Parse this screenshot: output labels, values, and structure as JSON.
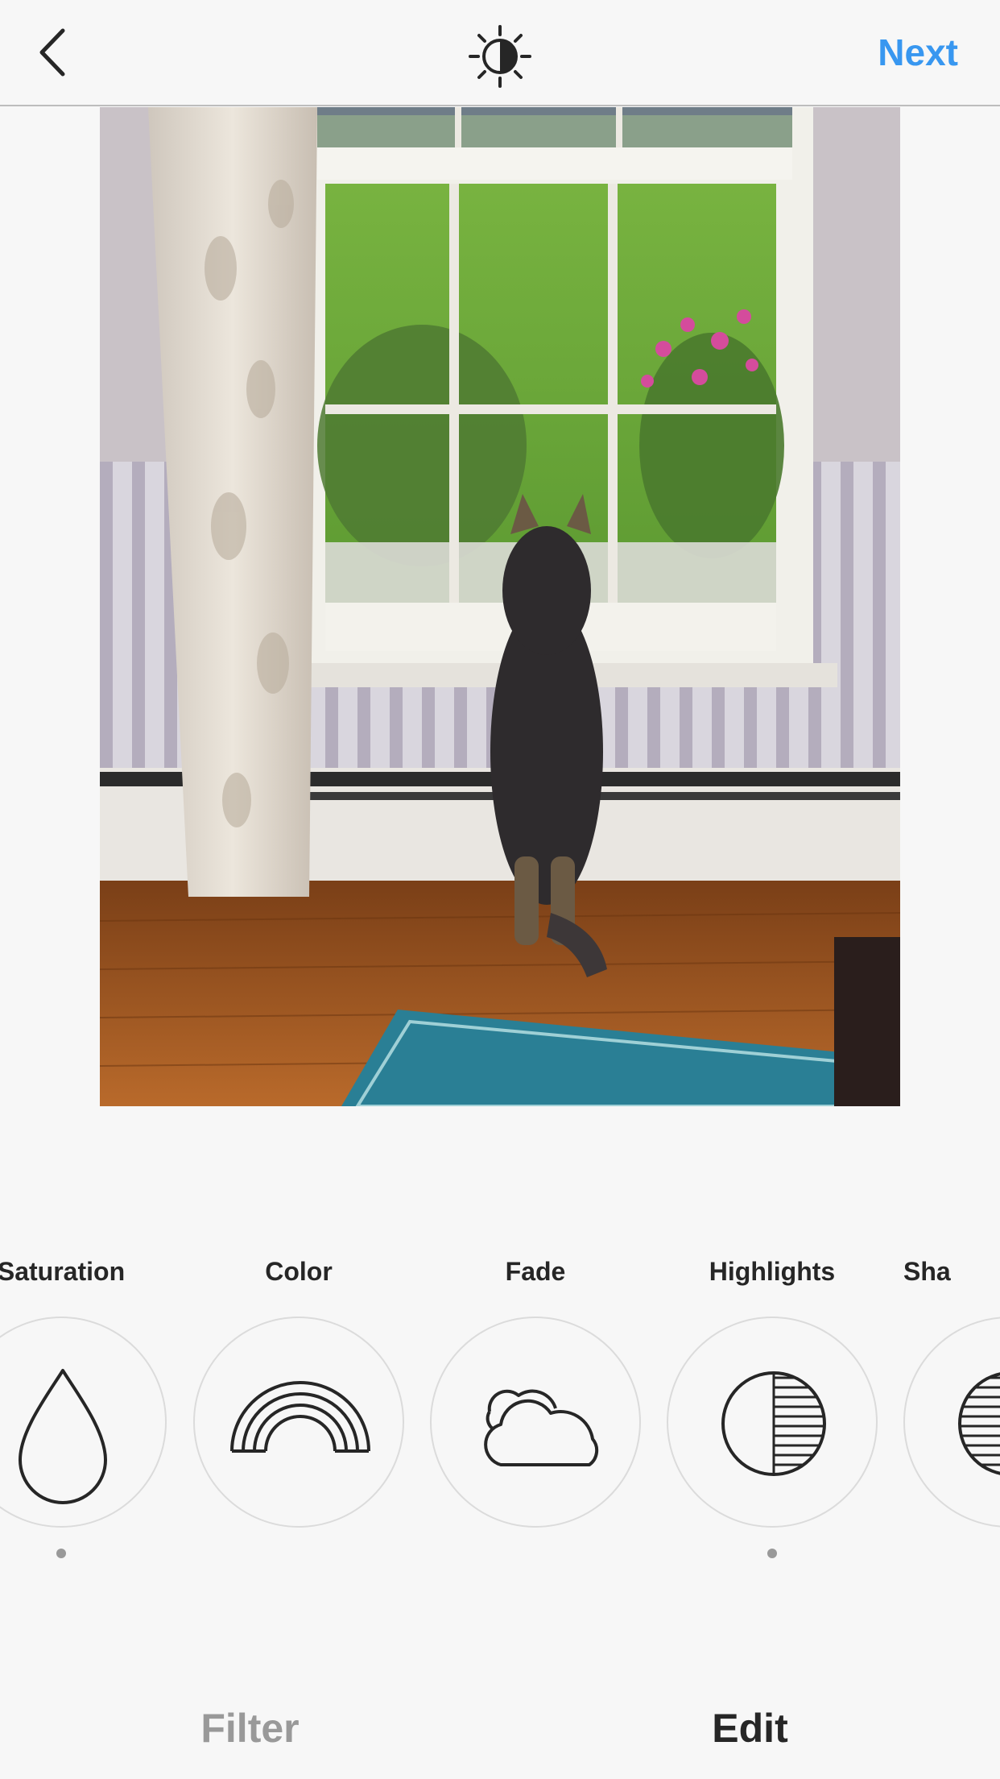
{
  "header": {
    "back_icon": "chevron-left-icon",
    "lux_icon": "lux-sun-icon",
    "next_label": "Next",
    "next_color": "#3897f0"
  },
  "photo": {
    "subject": "dog-at-window-photo"
  },
  "tools": [
    {
      "label": "Saturation",
      "icon": "droplet-icon",
      "adjusted": true
    },
    {
      "label": "Color",
      "icon": "rainbow-icon",
      "adjusted": false
    },
    {
      "label": "Fade",
      "icon": "cloud-icon",
      "adjusted": false
    },
    {
      "label": "Highlights",
      "icon": "highlights-icon",
      "adjusted": true
    },
    {
      "label": "Sha",
      "icon": "shadows-icon",
      "adjusted": false
    }
  ],
  "tabs": {
    "filter_label": "Filter",
    "edit_label": "Edit",
    "active": "Edit"
  }
}
